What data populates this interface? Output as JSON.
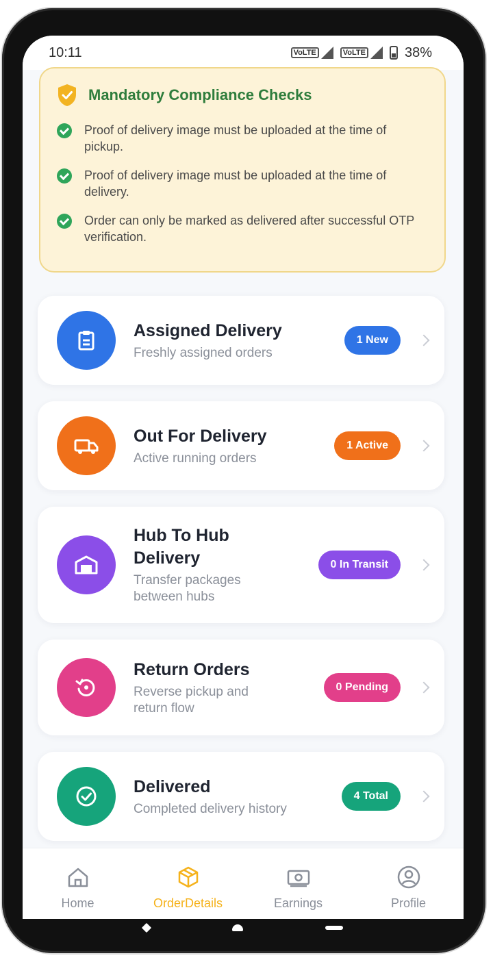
{
  "status_bar": {
    "time": "10:11",
    "battery": "38%"
  },
  "compliance": {
    "title": "Mandatory Compliance Checks",
    "items": [
      "Proof of delivery image must be uploaded at the time of pickup.",
      "Proof of delivery image must be uploaded at the time of delivery.",
      "Order can only be marked as delivered after successful OTP verification."
    ]
  },
  "menu": [
    {
      "title": "Assigned Delivery",
      "subtitle": "Freshly assigned orders",
      "badge": "1 New",
      "color": "#2f74e6"
    },
    {
      "title": "Out For Delivery",
      "subtitle": "Active running orders",
      "badge": "1 Active",
      "color": "#f0701a"
    },
    {
      "title": "Hub To Hub Delivery",
      "subtitle": "Transfer packages between hubs",
      "badge": "0 In Transit",
      "color": "#8b4ee8"
    },
    {
      "title": "Return Orders",
      "subtitle": "Reverse pickup and return flow",
      "badge": "0 Pending",
      "color": "#e23f8a"
    },
    {
      "title": "Delivered",
      "subtitle": "Completed delivery history",
      "badge": "4 Total",
      "color": "#16a47b"
    }
  ],
  "bottom_nav": {
    "items": [
      {
        "label": "Home",
        "icon": "home-icon"
      },
      {
        "label": "OrderDetails",
        "icon": "box-icon",
        "active": true
      },
      {
        "label": "Earnings",
        "icon": "cash-icon"
      },
      {
        "label": "Profile",
        "icon": "profile-icon"
      }
    ],
    "active_color": "#f5b21b"
  }
}
